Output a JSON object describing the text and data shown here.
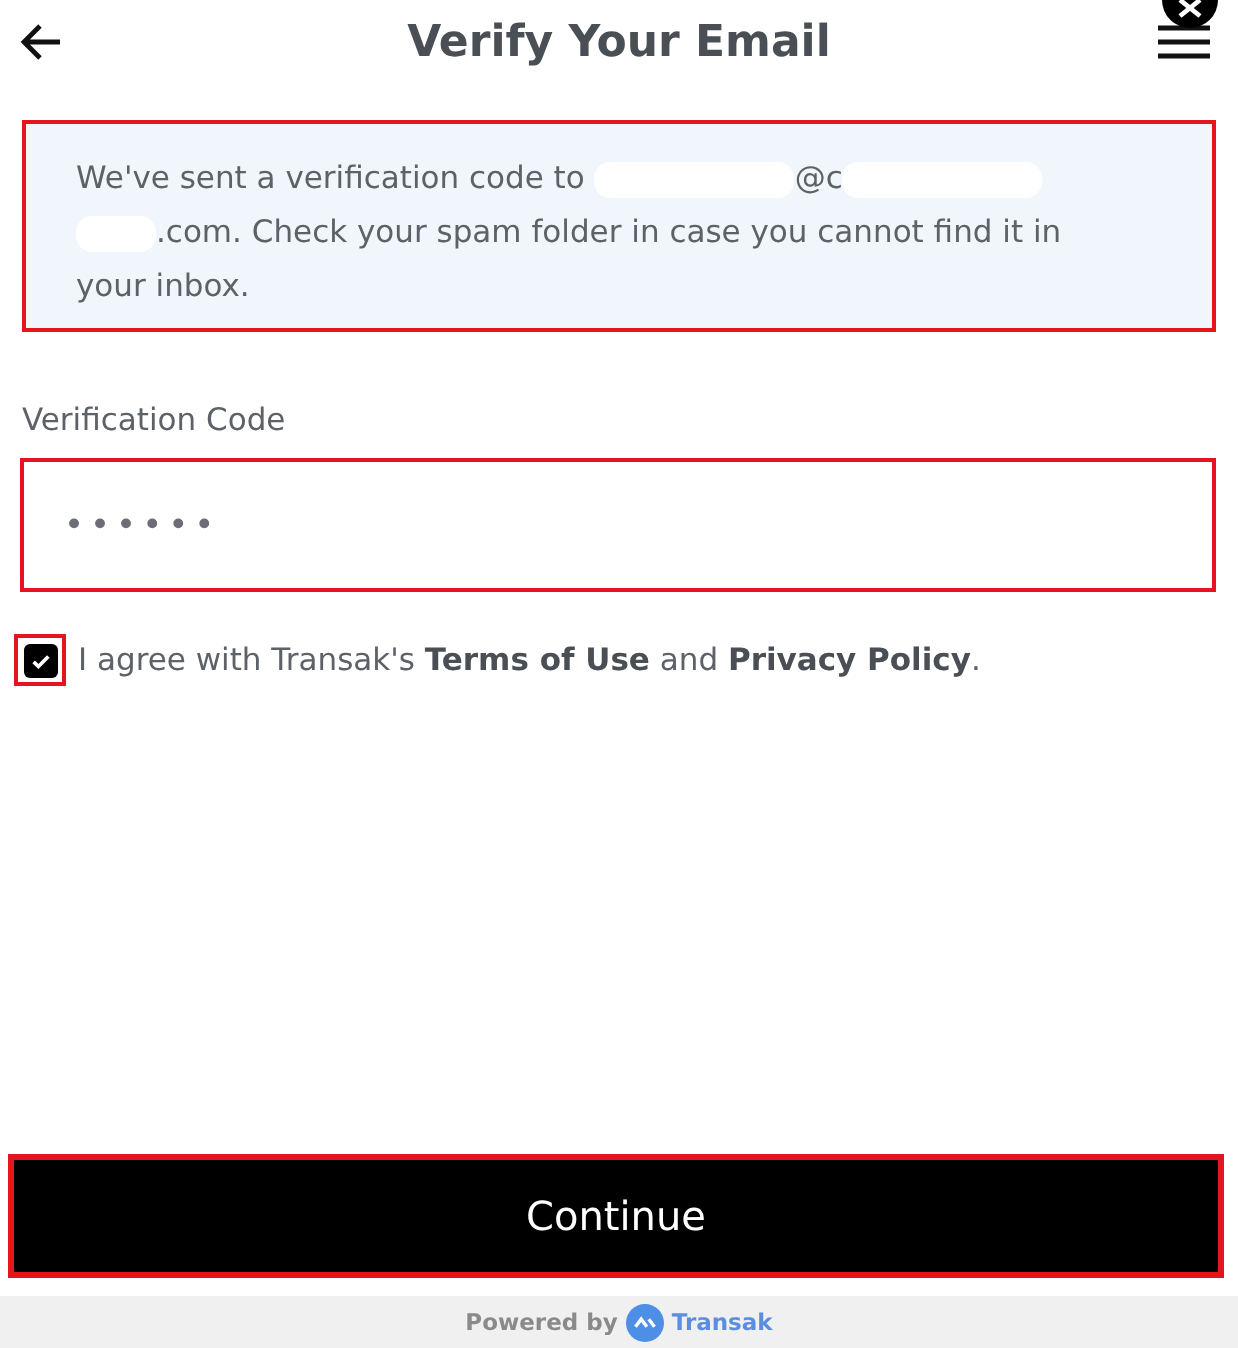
{
  "header": {
    "title": "Verify Your Email"
  },
  "notice": {
    "parts": [
      {
        "kind": "text",
        "text": "We've sent a verification code to "
      },
      {
        "kind": "redaction"
      },
      {
        "kind": "text",
        "text": "@c"
      },
      {
        "kind": "redaction"
      },
      {
        "kind": "redaction"
      },
      {
        "kind": "text",
        "text": ".com. Check your spam folder in case you cannot find it in your inbox."
      }
    ]
  },
  "code_field": {
    "label": "Verification Code",
    "value": "••••••"
  },
  "agreement": {
    "checked": true,
    "text": "I agree with Transak's **Terms of Use** and **Privacy Policy**."
  },
  "continue_button": {
    "label": "Continue"
  },
  "footer": {
    "powered_by": "Powered by",
    "brand": "Transak"
  }
}
